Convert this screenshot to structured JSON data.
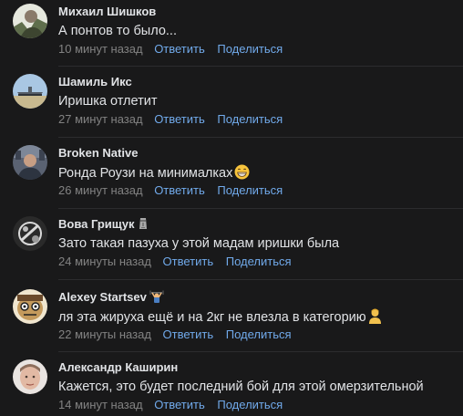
{
  "comments": [
    {
      "author": "Михаил Шишков",
      "text": "А понтов то было...",
      "time": "10 минут назад",
      "reply_label": "Ответить",
      "share_label": "Поделиться",
      "avatar_icon": "user-avatar-icon",
      "avatar_color": "#6f7d5c"
    },
    {
      "author": "Шамиль Икс",
      "text": "Иришка отлетит",
      "time": "27 минут назад",
      "reply_label": "Ответить",
      "share_label": "Поделиться",
      "avatar_icon": "user-avatar-icon",
      "avatar_color": "#8fb3d4"
    },
    {
      "author": "Broken Native",
      "text": "Ронда Роузи на минималках",
      "time": "26 минут назад",
      "reply_label": "Ответить",
      "share_label": "Поделиться",
      "avatar_icon": "user-avatar-icon",
      "avatar_color": "#4a5566",
      "text_emoji": "grinning-face-emoji"
    },
    {
      "author": "Вова Грищук",
      "text": "Зато такая пазуха у этой мадам иришки была",
      "time": "24 минуты назад",
      "reply_label": "Ответить",
      "share_label": "Поделиться",
      "avatar_icon": "user-avatar-icon",
      "avatar_color": "#3a3a3a",
      "author_emoji": "moai-emoji"
    },
    {
      "author": "Alexey Startsev",
      "text": "ля эта жируха ещё и на 2кг не влезла в категорию",
      "time": "22 минуты назад",
      "reply_label": "Ответить",
      "share_label": "Поделиться",
      "avatar_icon": "user-avatar-icon",
      "avatar_color": "#c9a97a",
      "author_emoji": "person-lifting-weights-emoji",
      "text_emoji": "person-emoji"
    },
    {
      "author": "Александр Каширин",
      "text": "Кажется, это будет последний бой для этой омерзительной",
      "time": "14 минут назад",
      "reply_label": "Ответить",
      "share_label": "Поделиться",
      "avatar_icon": "user-avatar-icon",
      "avatar_color": "#d8b8a8"
    }
  ],
  "colors": {
    "background": "#19191a",
    "text": "#e1e3e6",
    "meta": "#828282",
    "link": "#71aaeb"
  }
}
